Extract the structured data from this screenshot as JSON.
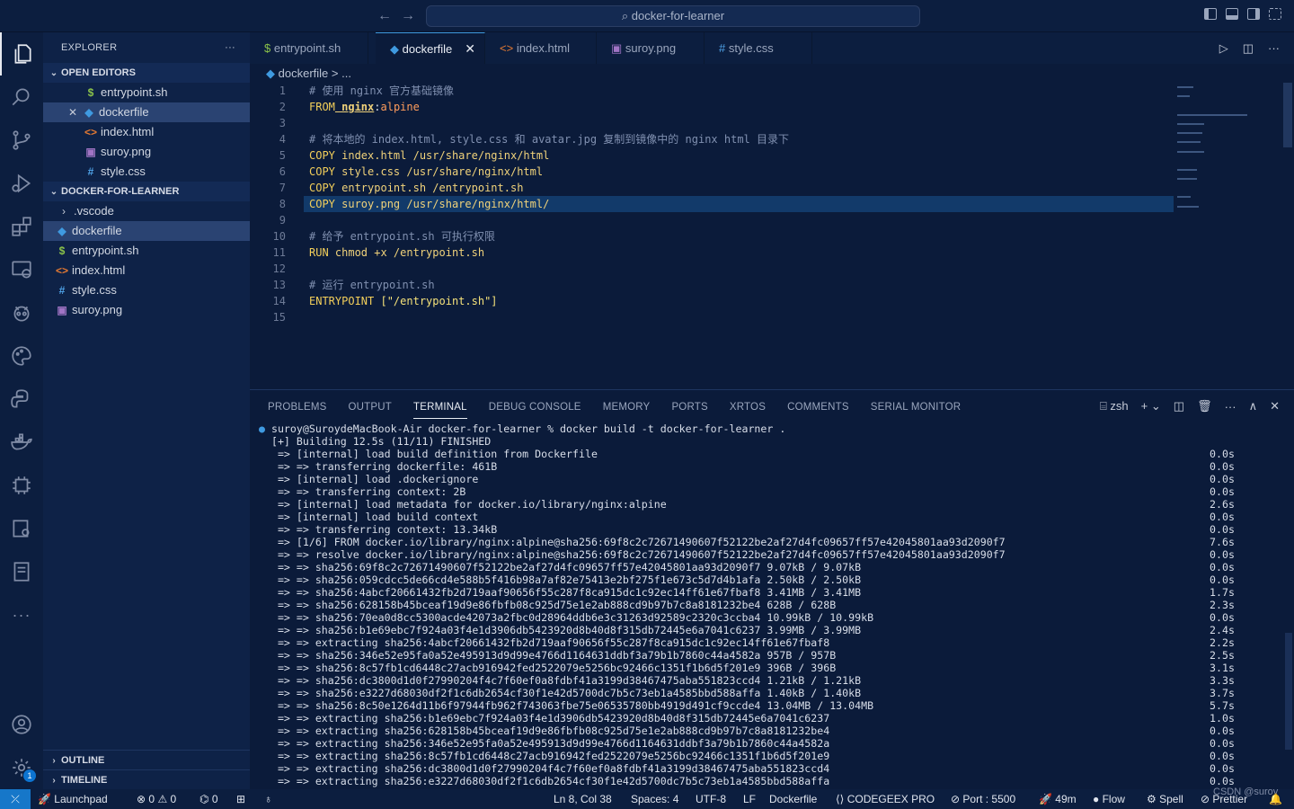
{
  "titlebar": {
    "back": "←",
    "forward": "→",
    "search": "docker-for-learner"
  },
  "explorer": {
    "title": "EXPLORER",
    "more": "···",
    "open_editors_label": "OPEN EDITORS",
    "open_editors": [
      {
        "name": "entrypoint.sh",
        "icon": "$"
      },
      {
        "name": "dockerfile",
        "icon": "🐳"
      },
      {
        "name": "index.html",
        "icon": "<>"
      },
      {
        "name": "suroy.png",
        "icon": "▣"
      },
      {
        "name": "style.css",
        "icon": "#"
      }
    ],
    "close_mark": "✕",
    "project_label": "DOCKER-FOR-LEARNER",
    "files": [
      {
        "name": ".vscode",
        "icon": "›"
      },
      {
        "name": "dockerfile",
        "icon": "🐳"
      },
      {
        "name": "entrypoint.sh",
        "icon": "$"
      },
      {
        "name": "index.html",
        "icon": "<>"
      },
      {
        "name": "style.css",
        "icon": "#"
      },
      {
        "name": "suroy.png",
        "icon": "▣"
      }
    ],
    "outline_label": "OUTLINE",
    "timeline_label": "TIMELINE"
  },
  "activity": {
    "settings_badge": "1",
    "more": "···"
  },
  "tabs": [
    {
      "label": "entrypoint.sh",
      "icon": "$"
    },
    {
      "label": "dockerfile",
      "icon": "🐳",
      "active": true
    },
    {
      "label": "index.html",
      "icon": "<>"
    },
    {
      "label": "suroy.png",
      "icon": "▣"
    },
    {
      "label": "style.css",
      "icon": "#"
    }
  ],
  "tab_close": "✕",
  "breadcrumb": {
    "file": "dockerfile",
    "sep": ">",
    "rest": "..."
  },
  "editor": {
    "line_numbers": [
      "1",
      "2",
      "3",
      "4",
      "5",
      "6",
      "7",
      "8",
      "9",
      "10",
      "11",
      "12",
      "13",
      "14",
      "15"
    ],
    "lines": [
      "# 使用 nginx 官方基础镜像",
      "FROM nginx:alpine",
      "",
      "# 将本地的 index.html, style.css 和 avatar.jpg 复制到镜像中的 nginx html 目录下",
      "COPY index.html /usr/share/nginx/html",
      "COPY style.css /usr/share/nginx/html",
      "COPY entrypoint.sh /entrypoint.sh",
      "COPY suroy.png /usr/share/nginx/html/",
      "",
      "# 给予 entrypoint.sh 可执行权限",
      "RUN chmod +x /entrypoint.sh",
      "",
      "# 运行 entrypoint.sh",
      "ENTRYPOINT [\"/entrypoint.sh\"]",
      ""
    ]
  },
  "panel": {
    "tabs": [
      "PROBLEMS",
      "OUTPUT",
      "TERMINAL",
      "DEBUG CONSOLE",
      "MEMORY",
      "PORTS",
      "XRTOS",
      "COMMENTS",
      "SERIAL MONITOR"
    ],
    "active_tab": "TERMINAL",
    "shell": "zsh",
    "terminal_lines": [
      {
        "text": "suroy@SuroydeMacBook-Air docker-for-learner % docker build -t docker-for-learner .",
        "time": ""
      },
      {
        "text": "[+] Building 12.5s (11/11) FINISHED",
        "time": ""
      },
      {
        "text": " => [internal] load build definition from Dockerfile",
        "time": "0.0s"
      },
      {
        "text": " => => transferring dockerfile: 461B",
        "time": "0.0s"
      },
      {
        "text": " => [internal] load .dockerignore",
        "time": "0.0s"
      },
      {
        "text": " => => transferring context: 2B",
        "time": "0.0s"
      },
      {
        "text": " => [internal] load metadata for docker.io/library/nginx:alpine",
        "time": "2.6s"
      },
      {
        "text": " => [internal] load build context",
        "time": "0.0s"
      },
      {
        "text": " => => transferring context: 13.34kB",
        "time": "0.0s"
      },
      {
        "text": " => [1/6] FROM docker.io/library/nginx:alpine@sha256:69f8c2c72671490607f52122be2af27d4fc09657ff57e42045801aa93d2090f7",
        "time": "7.6s"
      },
      {
        "text": " => => resolve docker.io/library/nginx:alpine@sha256:69f8c2c72671490607f52122be2af27d4fc09657ff57e42045801aa93d2090f7",
        "time": "0.0s"
      },
      {
        "text": " => => sha256:69f8c2c72671490607f52122be2af27d4fc09657ff57e42045801aa93d2090f7 9.07kB / 9.07kB",
        "time": "0.0s"
      },
      {
        "text": " => => sha256:059cdcc5de66cd4e588b5f416b98a7af82e75413e2bf275f1e673c5d7d4b1afa 2.50kB / 2.50kB",
        "time": "0.0s"
      },
      {
        "text": " => => sha256:4abcf20661432fb2d719aaf90656f55c287f8ca915dc1c92ec14ff61e67fbaf8 3.41MB / 3.41MB",
        "time": "1.7s"
      },
      {
        "text": " => => sha256:628158b45bceaf19d9e86fbfb08c925d75e1e2ab888cd9b97b7c8a8181232be4 628B / 628B",
        "time": "2.3s"
      },
      {
        "text": " => => sha256:70ea0d8cc5300acde42073a2fbc0d28964ddb6e3c31263d92589c2320c3ccba4 10.99kB / 10.99kB",
        "time": "0.0s"
      },
      {
        "text": " => => sha256:b1e69ebc7f924a03f4e1d3906db5423920d8b40d8f315db72445e6a7041c6237 3.99MB / 3.99MB",
        "time": "2.4s"
      },
      {
        "text": " => => extracting sha256:4abcf20661432fb2d719aaf90656f55c287f8ca915dc1c92ec14ff61e67fbaf8",
        "time": "2.2s"
      },
      {
        "text": " => => sha256:346e52e95fa0a52e495913d9d99e4766d1164631ddbf3a79b1b7860c44a4582a 957B / 957B",
        "time": "2.5s"
      },
      {
        "text": " => => sha256:8c57fb1cd6448c27acb916942fed2522079e5256bc92466c1351f1b6d5f201e9 396B / 396B",
        "time": "3.1s"
      },
      {
        "text": " => => sha256:dc3800d1d0f27990204f4c7f60ef0a8fdbf41a3199d38467475aba551823ccd4 1.21kB / 1.21kB",
        "time": "3.3s"
      },
      {
        "text": " => => sha256:e3227d68030df2f1c6db2654cf30f1e42d5700dc7b5c73eb1a4585bbd588affa 1.40kB / 1.40kB",
        "time": "3.7s"
      },
      {
        "text": " => => sha256:8c50e1264d11b6f97944fb962f743063fbe75e06535780bb4919d491cf9ccde4 13.04MB / 13.04MB",
        "time": "5.7s"
      },
      {
        "text": " => => extracting sha256:b1e69ebc7f924a03f4e1d3906db5423920d8b40d8f315db72445e6a7041c6237",
        "time": "1.0s"
      },
      {
        "text": " => => extracting sha256:628158b45bceaf19d9e86fbfb08c925d75e1e2ab888cd9b97b7c8a8181232be4",
        "time": "0.0s"
      },
      {
        "text": " => => extracting sha256:346e52e95fa0a52e495913d9d99e4766d1164631ddbf3a79b1b7860c44a4582a",
        "time": "0.0s"
      },
      {
        "text": " => => extracting sha256:8c57fb1cd6448c27acb916942fed2522079e5256bc92466c1351f1b6d5f201e9",
        "time": "0.0s"
      },
      {
        "text": " => => extracting sha256:dc3800d1d0f27990204f4c7f60ef0a8fdbf41a3199d38467475aba551823ccd4",
        "time": "0.0s"
      },
      {
        "text": " => => extracting sha256:e3227d68030df2f1c6db2654cf30f1e42d5700dc7b5c73eb1a4585bbd588affa",
        "time": "0.0s"
      }
    ]
  },
  "status": {
    "remote": "⤫",
    "launchpad": "Launchpad",
    "errors": "0",
    "warnings": "0",
    "ports": "0",
    "position": "Ln 8, Col 38",
    "spaces": "Spaces: 4",
    "encoding": "UTF-8",
    "eol": "LF",
    "language": "Dockerfile",
    "codegeex": "CODEGEEX PRO",
    "port": "Port : 5500",
    "time": "49m",
    "flow": "Flow",
    "spell": "Spell",
    "prettier": "Prettier",
    "watermark": "CSDN @suroy"
  },
  "colors": {
    "accent": "#3f9ae0",
    "statusbar_remote": "#1677c9",
    "sidebar_bg": "#0e2247",
    "editor_bg": "#0b1b3a"
  }
}
